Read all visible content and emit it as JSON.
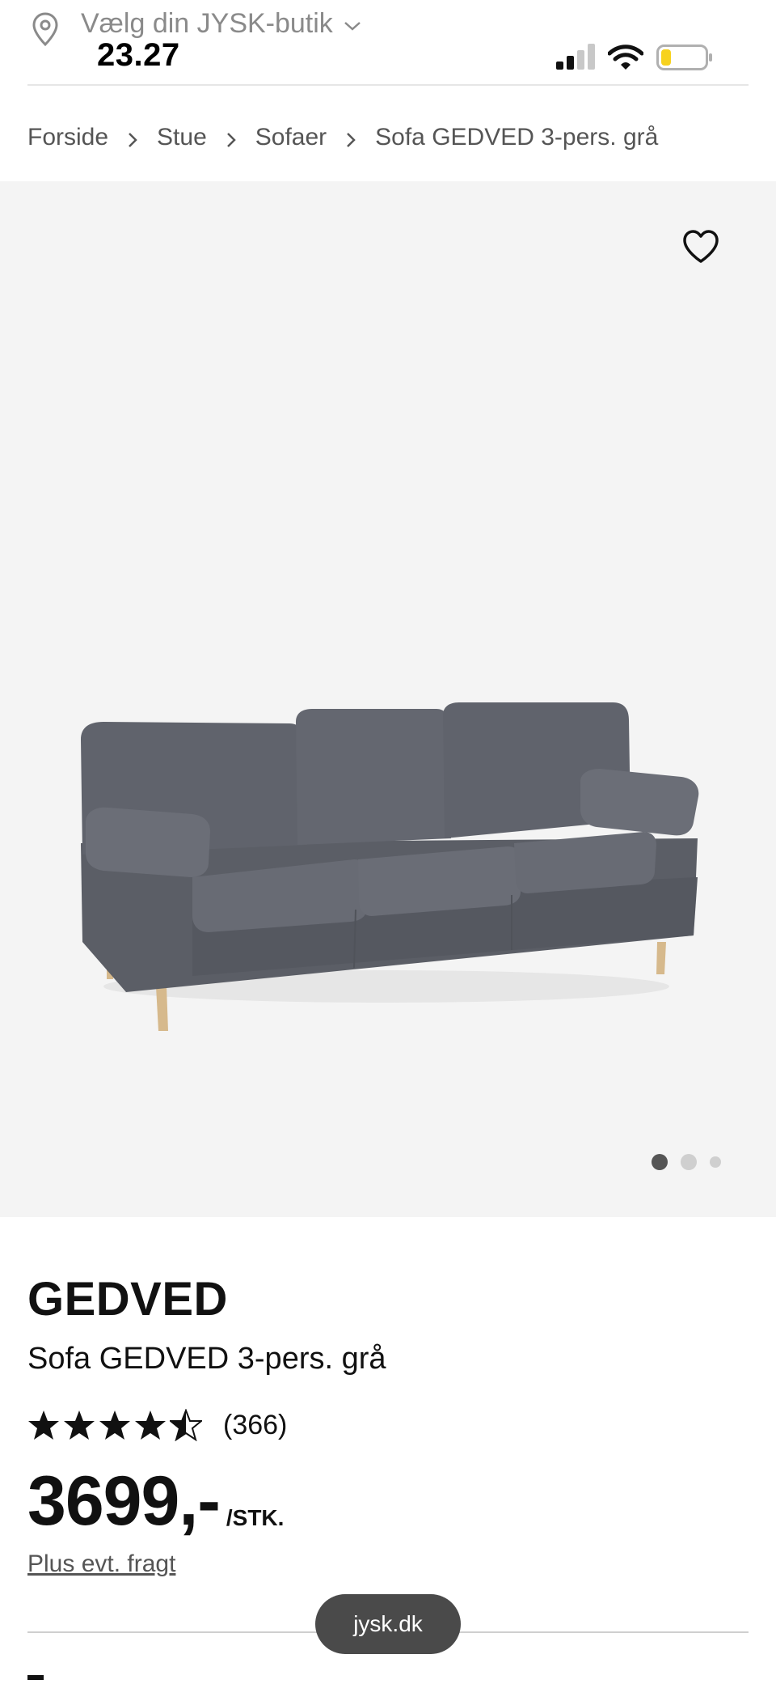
{
  "store_selector": {
    "label": "Vælg din JYSK-butik",
    "icon": "location-pin-icon"
  },
  "status_bar": {
    "time": "23.27",
    "battery_color": "#f7d21e"
  },
  "breadcrumb": [
    {
      "label": "Forside"
    },
    {
      "label": "Stue"
    },
    {
      "label": "Sofaer"
    },
    {
      "label": "Sofa GEDVED 3-pers. grå"
    }
  ],
  "gallery": {
    "image_count": 3,
    "active_index": 0,
    "favorite_icon": "heart-outline-icon",
    "background": "#f4f4f4"
  },
  "product": {
    "brand": "GEDVED",
    "name": "Sofa GEDVED 3-pers. grå",
    "rating": 4.5,
    "rating_max": 5,
    "reviews": "(366)",
    "price": "3699,-",
    "unit": "/STK.",
    "shipping_note": "Plus evt. fragt"
  },
  "browser": {
    "url": "jysk.dk"
  }
}
